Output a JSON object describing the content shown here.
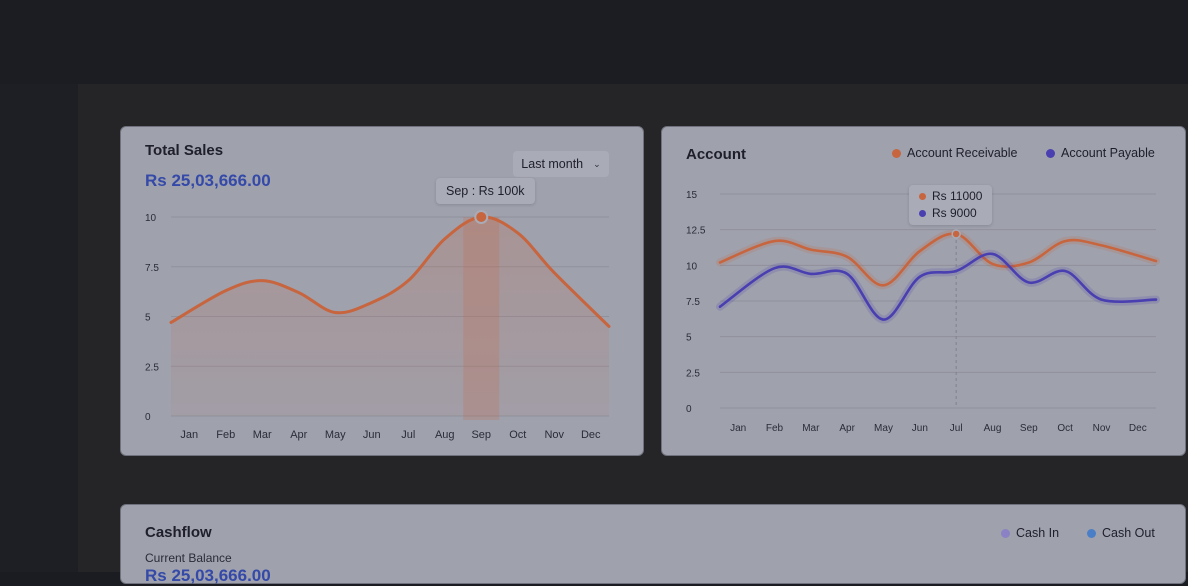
{
  "colors": {
    "receivable": "#c7653f",
    "payable": "#4a3fb0",
    "sales_line": "#c7653f",
    "cash_in": "#8a82c4",
    "cash_out": "#4a7fc8",
    "accent_value": "#3449a8"
  },
  "total_sales": {
    "title": "Total Sales",
    "value": "Rs 25,03,666.00",
    "dropdown_label": "Last month",
    "dropdown_icon": "chevron-down-icon",
    "tooltip": "Sep : Rs 100k"
  },
  "account": {
    "title": "Account",
    "legend": {
      "receivable": "Account Receivable",
      "payable": "Account Payable"
    },
    "tooltip": {
      "receivable": "Rs 11000",
      "payable": "Rs 9000"
    }
  },
  "cashflow": {
    "title": "Cashflow",
    "subtitle": "Current Balance",
    "value": "Rs 25,03,666.00",
    "legend": {
      "cash_in": "Cash In",
      "cash_out": "Cash Out"
    }
  },
  "chart_data": [
    {
      "type": "area",
      "categories": [
        "Jan",
        "Feb",
        "Mar",
        "Apr",
        "May",
        "Jun",
        "Jul",
        "Aug",
        "Sep",
        "Oct",
        "Nov",
        "Dec"
      ],
      "series": [
        {
          "values": [
            4.7,
            6.3,
            6.8,
            6.2,
            5.2,
            5.7,
            6.8,
            8.9,
            10,
            9.2,
            7.2,
            4.5
          ]
        }
      ],
      "highlight": "Sep",
      "ylim": [
        0,
        10
      ],
      "yticks": [
        "0",
        "2.5",
        "5",
        "7.5",
        "10"
      ]
    },
    {
      "type": "line",
      "categories": [
        "Jan",
        "Feb",
        "Mar",
        "Apr",
        "May",
        "Jun",
        "Jul",
        "Aug",
        "Sep",
        "Oct",
        "Nov",
        "Dec"
      ],
      "series": [
        {
          "name": "Account Receivable",
          "values": [
            10.2,
            11.7,
            11.1,
            10.6,
            8.6,
            11.0,
            12.2,
            10.1,
            10.2,
            11.7,
            11.4,
            10.3
          ]
        },
        {
          "name": "Account Payable",
          "values": [
            7.1,
            9.8,
            9.4,
            9.4,
            6.2,
            9.2,
            9.6,
            10.8,
            8.8,
            9.6,
            7.6,
            7.6
          ]
        }
      ],
      "ylim": [
        0,
        15
      ],
      "yticks": [
        "0",
        "2.5",
        "5",
        "7.5",
        "10",
        "12.5",
        "15"
      ],
      "highlight": "Jul"
    }
  ]
}
